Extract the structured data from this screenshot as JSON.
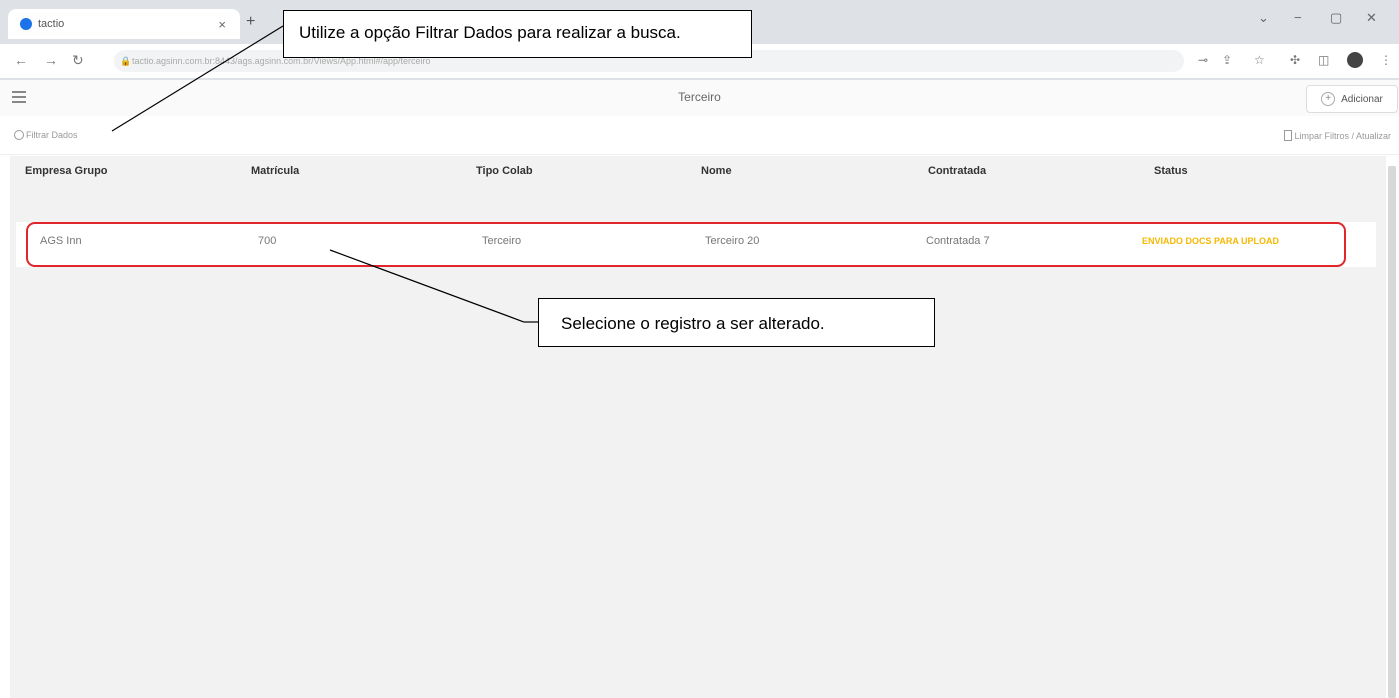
{
  "browser": {
    "tab_title": "tactio",
    "tab_close": "×",
    "new_tab": "+",
    "window_controls": [
      "⌄",
      "−",
      "▢",
      "✕"
    ],
    "url": "tactio.agsinn.com.br:8443/ags.agsinn.com.br/Views/App.html#/app/terceiro"
  },
  "app": {
    "title": "Terceiro",
    "add_button_label": "Adicionar",
    "filter_placeholder": "Filtrar Dados",
    "clear_filters_label": "Limpar Filtros / Atualizar"
  },
  "table": {
    "columns": [
      "Empresa Grupo",
      "Matrícula",
      "Tipo Colab",
      "Nome",
      "Contratada",
      "Status"
    ],
    "rows": [
      {
        "empresa_grupo": "AGS Inn",
        "matricula": "700",
        "tipo_colab": "Terceiro",
        "nome": "Terceiro 20",
        "contratada": "Contratada 7",
        "status": "ENVIADO DOCS PARA UPLOAD"
      }
    ]
  },
  "annotations": {
    "callout_filter": "Utilize a opção Filtrar Dados para realizar a busca.",
    "callout_select": "Selecione o registro a ser alterado."
  },
  "colors": {
    "highlight_border": "#e0262b",
    "status_color": "#f5b800"
  }
}
